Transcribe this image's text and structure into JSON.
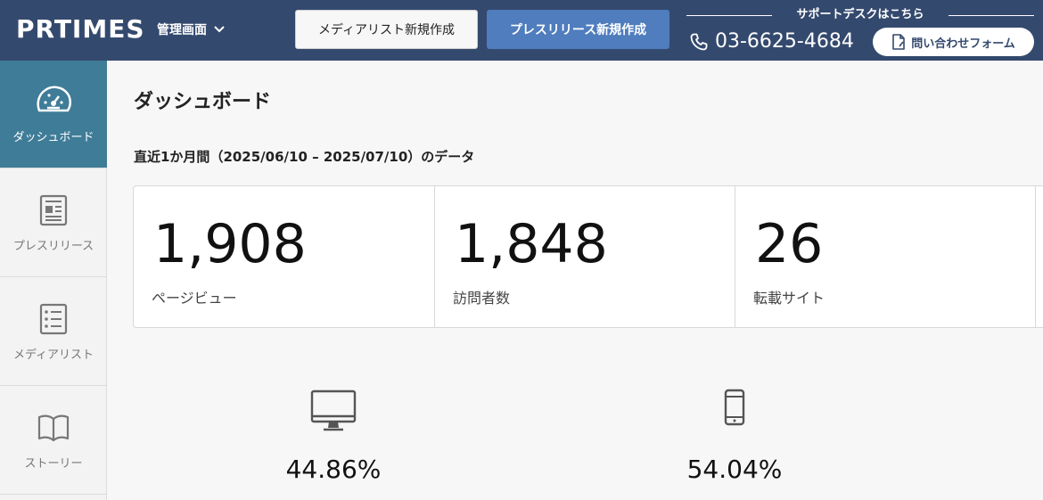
{
  "header": {
    "logo": "PRTIMES",
    "admin_menu": "管理画面",
    "media_button": "メディアリスト新規作成",
    "release_button": "プレスリリース新規作成",
    "support_title": "サポートデスクはこちら",
    "phone": "03-6625-4684",
    "contact_button": "問い合わせフォーム"
  },
  "sidebar": {
    "items": [
      {
        "label": "ダッシュボード",
        "icon": "dashboard-gauge-icon",
        "active": true
      },
      {
        "label": "プレスリリース",
        "icon": "newspaper-icon",
        "active": false
      },
      {
        "label": "メディアリスト",
        "icon": "list-icon",
        "active": false
      },
      {
        "label": "ストーリー",
        "icon": "book-icon",
        "active": false
      }
    ]
  },
  "main": {
    "title": "ダッシュボード",
    "period": "直近1か月間（2025/06/10 – 2025/07/10）のデータ",
    "stats": [
      {
        "value": "1,908",
        "label": "ページビュー"
      },
      {
        "value": "1,848",
        "label": "訪問者数"
      },
      {
        "value": "26",
        "label": "転載サイト"
      }
    ],
    "devices": [
      {
        "icon": "desktop-icon",
        "percent": "44.86%"
      },
      {
        "icon": "smartphone-icon",
        "percent": "54.04%"
      }
    ]
  },
  "colors": {
    "header_bg": "#34496e",
    "primary_button": "#4f7dbd",
    "sidebar_active": "#3f7c98"
  }
}
